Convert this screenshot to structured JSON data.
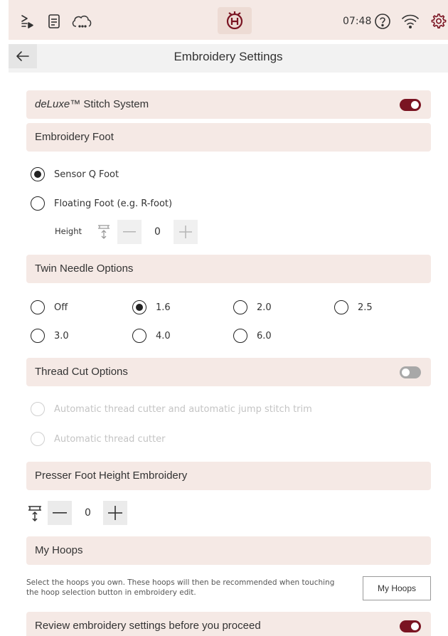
{
  "statusbar": {
    "time": "07:48",
    "icons": [
      "sewing-mode-icon",
      "document-icon",
      "cloud-icon",
      "husqvarna-logo",
      "help-icon",
      "wifi-icon",
      "settings-gear-icon"
    ]
  },
  "header": {
    "title": "Embroidery Settings"
  },
  "deluxe": {
    "label_italic": "deLuxe",
    "label_tm": "™",
    "label_rest": " Stitch System",
    "enabled": true
  },
  "embroidery_foot": {
    "title": "Embroidery Foot",
    "options": [
      {
        "label": "Sensor Q Foot",
        "selected": true
      },
      {
        "label": "Floating Foot (e.g. R-foot)",
        "selected": false
      }
    ],
    "height_label": "Height",
    "height_value": "0"
  },
  "twin_needle": {
    "title": "Twin Needle Options",
    "options": [
      {
        "label": "Off",
        "selected": false
      },
      {
        "label": "1.6",
        "selected": true
      },
      {
        "label": "2.0",
        "selected": false
      },
      {
        "label": "2.5",
        "selected": false
      },
      {
        "label": "3.0",
        "selected": false
      },
      {
        "label": "4.0",
        "selected": false
      },
      {
        "label": "6.0",
        "selected": false
      }
    ]
  },
  "thread_cut": {
    "title": "Thread Cut Options",
    "enabled": false,
    "options": [
      {
        "label": "Automatic thread cutter and automatic jump stitch trim",
        "selected": false,
        "disabled": true
      },
      {
        "label": "Automatic thread cutter",
        "selected": false,
        "disabled": true
      }
    ]
  },
  "presser_foot": {
    "title": "Presser Foot Height Embroidery",
    "value": "0"
  },
  "my_hoops": {
    "title": "My Hoops",
    "description": "Select the hoops you own. These hoops will then be recommended when touching the hoop selection button in embroidery edit.",
    "button_label": "My Hoops"
  },
  "review": {
    "label": "Review embroidery settings before you proceed",
    "enabled": true
  },
  "colors": {
    "accent": "#7a1422",
    "section_bg": "#f5e9e5",
    "topbar_bg": "#f5e9e5"
  }
}
